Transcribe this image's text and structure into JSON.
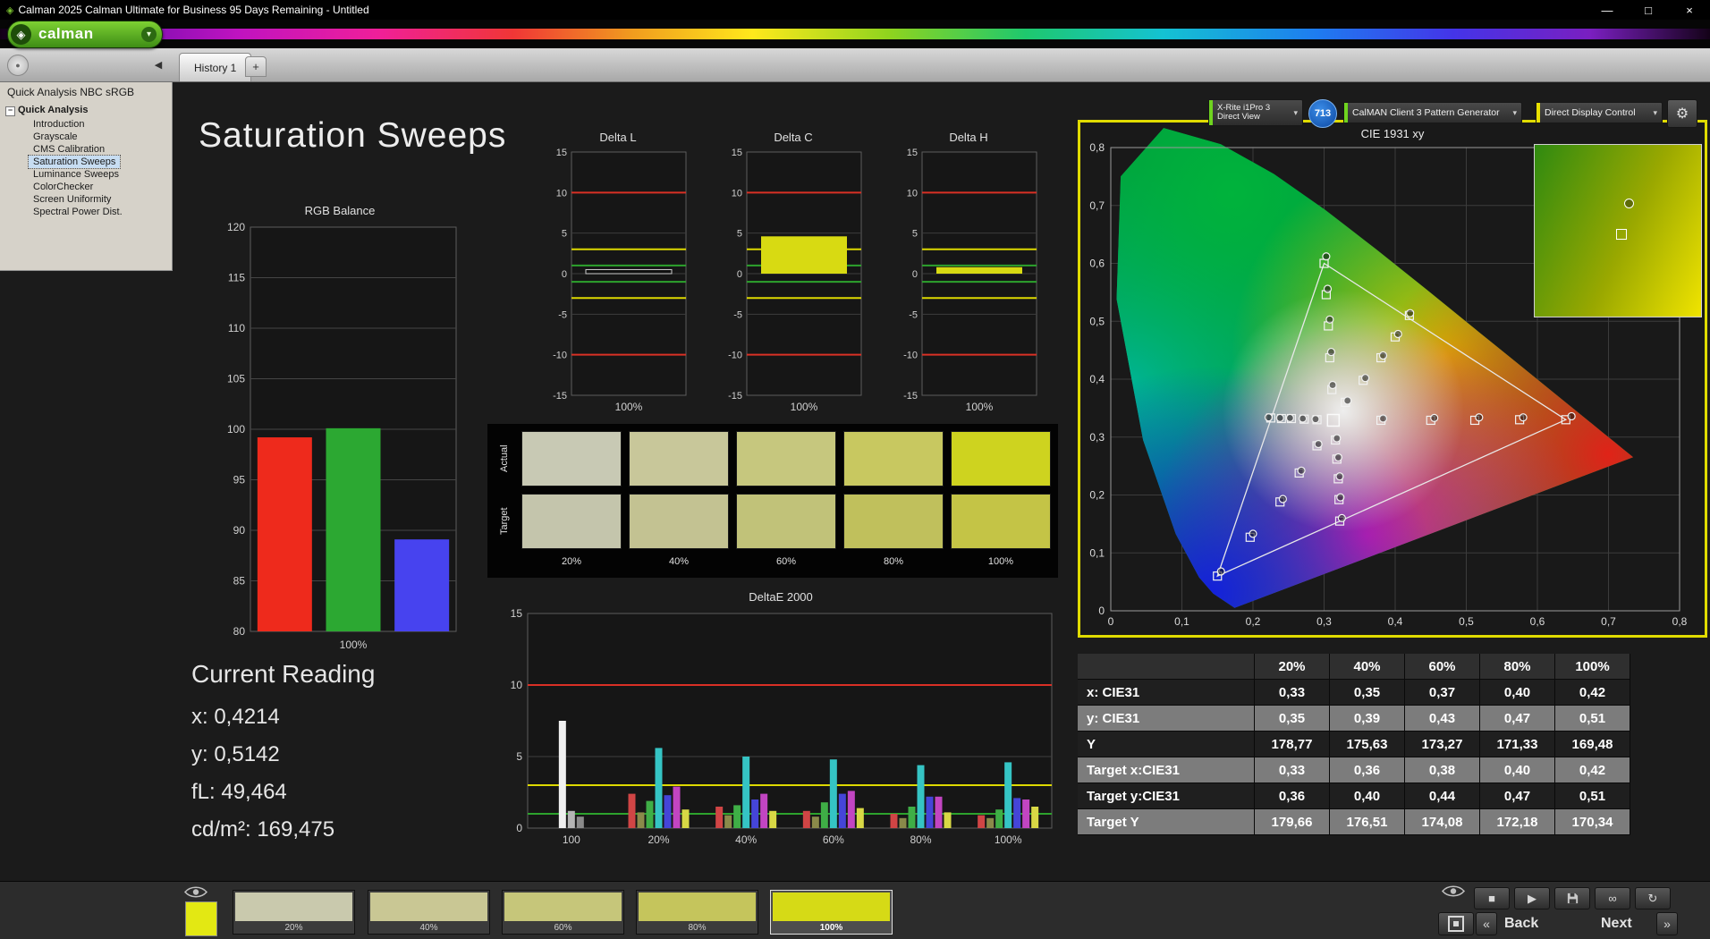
{
  "window": {
    "title": "Calman 2025 Calman Ultimate for Business 95 Days Remaining  - Untitled"
  },
  "icons": {
    "diamond": "◈",
    "dropdown": "▾",
    "gear": "⚙",
    "collapse_left": "◀",
    "pin": "●",
    "add": "+",
    "stop": "■",
    "play": "▶",
    "infinity": "∞",
    "refresh": "↻",
    "back_chevrons": "«",
    "next_chevrons": "»",
    "minimize": "—",
    "maximize": "□",
    "close": "×"
  },
  "brand": {
    "logo_text": "calman"
  },
  "tabs": {
    "history": "History 1"
  },
  "devices": {
    "meter_line1": "X-Rite i1Pro 3",
    "meter_line2": "Direct View",
    "meter_count": "713",
    "pattern": "CalMAN Client 3 Pattern Generator",
    "display": "Direct Display Control"
  },
  "sidebar": {
    "header": "Quick Analysis NBC sRGB",
    "root": "Quick Analysis",
    "items": [
      "Introduction",
      "Grayscale",
      "CMS Calibration",
      "Saturation Sweeps",
      "Luminance Sweeps",
      "ColorChecker",
      "Screen Uniformity",
      "Spectral Power Dist."
    ],
    "selected_index": 3
  },
  "page": {
    "title": "Saturation Sweeps"
  },
  "current_reading": {
    "title": "Current Reading",
    "x": "x: 0,4214",
    "y": "y: 0,5142",
    "fl": "fL: 49,464",
    "cd": "cd/m²: 169,475"
  },
  "swatch_panel": {
    "row_labels": [
      "Actual",
      "Target"
    ],
    "col_labels": [
      "20%",
      "40%",
      "60%",
      "80%",
      "100%"
    ],
    "actual_colors": [
      "#c8c9b4",
      "#c8c79a",
      "#c6c77e",
      "#c8c860",
      "#ced31f"
    ],
    "target_colors": [
      "#c4c5ac",
      "#c3c292",
      "#c1c279",
      "#c0c05c",
      "#c4c446"
    ]
  },
  "saturation_table": {
    "columns": [
      "20%",
      "40%",
      "60%",
      "80%",
      "100%"
    ],
    "rows": [
      {
        "label": "x: CIE31",
        "values": [
          "0,33",
          "0,35",
          "0,37",
          "0,40",
          "0,42"
        ]
      },
      {
        "label": "y: CIE31",
        "values": [
          "0,35",
          "0,39",
          "0,43",
          "0,47",
          "0,51"
        ]
      },
      {
        "label": "Y",
        "values": [
          "178,77",
          "175,63",
          "173,27",
          "171,33",
          "169,48"
        ]
      },
      {
        "label": "Target x:CIE31",
        "values": [
          "0,33",
          "0,36",
          "0,38",
          "0,40",
          "0,42"
        ]
      },
      {
        "label": "Target y:CIE31",
        "values": [
          "0,36",
          "0,40",
          "0,44",
          "0,47",
          "0,51"
        ]
      },
      {
        "label": "Target Y",
        "values": [
          "179,66",
          "176,51",
          "174,08",
          "172,18",
          "170,34"
        ]
      }
    ]
  },
  "bottom_bar": {
    "pattern_color": "#e3e813",
    "levels": [
      {
        "label": "20%",
        "color": "#c9c9ad",
        "selected": false
      },
      {
        "label": "40%",
        "color": "#c9c794",
        "selected": false
      },
      {
        "label": "60%",
        "color": "#c6c67a",
        "selected": false
      },
      {
        "label": "80%",
        "color": "#c5c55c",
        "selected": false
      },
      {
        "label": "100%",
        "color": "#d6da16",
        "selected": true
      }
    ],
    "back": "Back",
    "next": "Next"
  },
  "chart_data": [
    {
      "id": "rgb_balance",
      "type": "bar",
      "title": "RGB Balance",
      "categories": [
        "Red",
        "Green",
        "Blue"
      ],
      "values": [
        99.2,
        100.1,
        89.1
      ],
      "colors": [
        "#ee2a1c",
        "#2ca832",
        "#4743ef"
      ],
      "ylim": [
        80,
        120
      ],
      "ytick_step": 5,
      "xlabel": "100%"
    },
    {
      "id": "delta_l",
      "type": "bar",
      "title": "Delta L",
      "categories": [
        "100%"
      ],
      "values": [
        0.5
      ],
      "colors": [
        "#101010"
      ],
      "bar_stroke": "#cccccc",
      "ylim": [
        -15,
        15
      ],
      "ytick_step": 5,
      "xlabel": "100%",
      "ref_lines": [
        {
          "value": 10,
          "color": "#d93025"
        },
        {
          "value": -10,
          "color": "#d93025"
        },
        {
          "value": 3,
          "color": "#ded900"
        },
        {
          "value": -3,
          "color": "#ded900"
        },
        {
          "value": 1,
          "color": "#2da32d"
        },
        {
          "value": -1,
          "color": "#2da32d"
        }
      ]
    },
    {
      "id": "delta_c",
      "type": "bar",
      "title": "Delta C",
      "categories": [
        "100%"
      ],
      "values": [
        4.6
      ],
      "colors": [
        "#d8da12"
      ],
      "ylim": [
        -15,
        15
      ],
      "ytick_step": 5,
      "xlabel": "100%",
      "ref_lines": [
        {
          "value": 10,
          "color": "#d93025"
        },
        {
          "value": -10,
          "color": "#d93025"
        },
        {
          "value": 3,
          "color": "#ded900"
        },
        {
          "value": -3,
          "color": "#ded900"
        },
        {
          "value": 1,
          "color": "#2da32d"
        },
        {
          "value": -1,
          "color": "#2da32d"
        }
      ]
    },
    {
      "id": "delta_h",
      "type": "bar",
      "title": "Delta H",
      "categories": [
        "100%"
      ],
      "values": [
        0.8
      ],
      "colors": [
        "#d8da12"
      ],
      "ylim": [
        -15,
        15
      ],
      "ytick_step": 5,
      "xlabel": "100%",
      "ref_lines": [
        {
          "value": 10,
          "color": "#d93025"
        },
        {
          "value": -10,
          "color": "#d93025"
        },
        {
          "value": 3,
          "color": "#ded900"
        },
        {
          "value": -3,
          "color": "#ded900"
        },
        {
          "value": 1,
          "color": "#2da32d"
        },
        {
          "value": -1,
          "color": "#2da32d"
        }
      ]
    },
    {
      "id": "deltae2000",
      "type": "grouped-bar",
      "title": "DeltaE 2000",
      "ylim": [
        0,
        15
      ],
      "yticks": [
        0,
        5,
        10,
        15
      ],
      "ref_lines": [
        {
          "value": 10,
          "color": "#d93025"
        },
        {
          "value": 3,
          "color": "#ded900"
        },
        {
          "value": 1,
          "color": "#2da32d"
        }
      ],
      "palette": [
        "#d04545",
        "#8a8a4a",
        "#3fae46",
        "#35c4c4",
        "#4545d8",
        "#c245c2",
        "#d8d845"
      ],
      "groups": [
        {
          "label": "100",
          "colors": [
            "#f0f0f0",
            "#b4b4b4",
            "#8a8a8a"
          ],
          "values": [
            7.5,
            1.2,
            0.8
          ]
        },
        {
          "label": "20%",
          "values": [
            2.4,
            1.1,
            1.9,
            5.6,
            2.3,
            2.9,
            1.3
          ]
        },
        {
          "label": "40%",
          "values": [
            1.5,
            0.9,
            1.6,
            5.0,
            2.0,
            2.4,
            1.2
          ]
        },
        {
          "label": "60%",
          "values": [
            1.2,
            0.8,
            1.8,
            4.8,
            2.4,
            2.6,
            1.4
          ]
        },
        {
          "label": "80%",
          "values": [
            1.0,
            0.7,
            1.5,
            4.4,
            2.2,
            2.2,
            1.1
          ]
        },
        {
          "label": "100%",
          "values": [
            0.9,
            0.7,
            1.3,
            4.6,
            2.1,
            2.0,
            1.5
          ]
        }
      ]
    },
    {
      "id": "cie1931",
      "type": "scatter",
      "title": "CIE 1931 xy",
      "xlim": [
        0,
        0.8
      ],
      "ylim": [
        0,
        0.8
      ],
      "tick_labels": [
        "0",
        "0,1",
        "0,2",
        "0,3",
        "0,4",
        "0,5",
        "0,6",
        "0,7",
        "0,8"
      ],
      "white_point": [
        0.313,
        0.329
      ],
      "srgb_triangle": [
        [
          0.64,
          0.33
        ],
        [
          0.3,
          0.6
        ],
        [
          0.15,
          0.06
        ]
      ],
      "sweeps": [
        {
          "name": "red",
          "targets": [
            [
              0.38,
              0.329
            ],
            [
              0.45,
              0.329
            ],
            [
              0.512,
              0.329
            ],
            [
              0.575,
              0.33
            ],
            [
              0.64,
              0.33
            ]
          ],
          "measured": [
            [
              0.383,
              0.332
            ],
            [
              0.455,
              0.333
            ],
            [
              0.518,
              0.334
            ],
            [
              0.58,
              0.334
            ],
            [
              0.648,
              0.336
            ]
          ]
        },
        {
          "name": "green",
          "targets": [
            [
              0.311,
              0.382
            ],
            [
              0.308,
              0.437
            ],
            [
              0.306,
              0.492
            ],
            [
              0.303,
              0.546
            ],
            [
              0.3,
              0.6
            ]
          ],
          "measured": [
            [
              0.312,
              0.39
            ],
            [
              0.31,
              0.447
            ],
            [
              0.308,
              0.503
            ],
            [
              0.305,
              0.556
            ],
            [
              0.303,
              0.612
            ]
          ]
        },
        {
          "name": "blue",
          "targets": [
            [
              0.29,
              0.285
            ],
            [
              0.265,
              0.238
            ],
            [
              0.238,
              0.188
            ],
            [
              0.196,
              0.127
            ],
            [
              0.15,
              0.06
            ]
          ],
          "measured": [
            [
              0.292,
              0.288
            ],
            [
              0.268,
              0.242
            ],
            [
              0.242,
              0.193
            ],
            [
              0.2,
              0.133
            ],
            [
              0.155,
              0.068
            ]
          ]
        },
        {
          "name": "cyan",
          "targets": [
            [
              0.29,
              0.33
            ],
            [
              0.272,
              0.331
            ],
            [
              0.254,
              0.332
            ],
            [
              0.24,
              0.332
            ],
            [
              0.225,
              0.333
            ]
          ],
          "measured": [
            [
              0.288,
              0.331
            ],
            [
              0.27,
              0.332
            ],
            [
              0.252,
              0.333
            ],
            [
              0.238,
              0.333
            ],
            [
              0.222,
              0.334
            ]
          ]
        },
        {
          "name": "magenta",
          "targets": [
            [
              0.316,
              0.295
            ],
            [
              0.318,
              0.262
            ],
            [
              0.32,
              0.228
            ],
            [
              0.321,
              0.192
            ],
            [
              0.322,
              0.155
            ]
          ],
          "measured": [
            [
              0.318,
              0.298
            ],
            [
              0.32,
              0.265
            ],
            [
              0.322,
              0.232
            ],
            [
              0.323,
              0.196
            ],
            [
              0.325,
              0.16
            ]
          ]
        },
        {
          "name": "yellow",
          "targets": [
            [
              0.33,
              0.36
            ],
            [
              0.355,
              0.398
            ],
            [
              0.38,
              0.437
            ],
            [
              0.4,
              0.473
            ],
            [
              0.42,
              0.51
            ]
          ],
          "measured": [
            [
              0.333,
              0.363
            ],
            [
              0.358,
              0.402
            ],
            [
              0.383,
              0.441
            ],
            [
              0.404,
              0.478
            ],
            [
              0.421,
              0.514
            ]
          ]
        }
      ]
    }
  ]
}
